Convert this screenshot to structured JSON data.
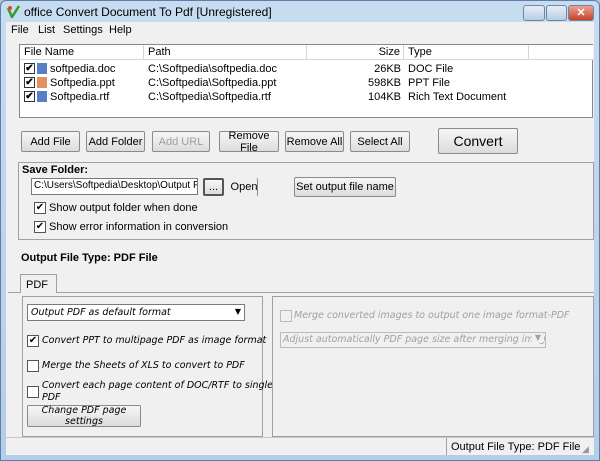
{
  "window": {
    "title": "office Convert Document To Pdf [Unregistered]"
  },
  "menu": [
    "File",
    "List",
    "Settings",
    "Help"
  ],
  "list": {
    "columns": [
      "File Name",
      "Path",
      "Size",
      "Type"
    ],
    "rows": [
      {
        "name": "softpedia.doc",
        "path": "C:\\Softpedia\\softpedia.doc",
        "size": "26KB",
        "type": "DOC File",
        "icon": "word-doc-icon",
        "checked": true
      },
      {
        "name": "Softpedia.ppt",
        "path": "C:\\Softpedia\\Softpedia.ppt",
        "size": "598KB",
        "type": "PPT File",
        "icon": "ppt-icon",
        "checked": true
      },
      {
        "name": "Softpedia.rtf",
        "path": "C:\\Softpedia\\Softpedia.rtf",
        "size": "104KB",
        "type": "Rich Text Document",
        "icon": "rtf-icon",
        "checked": true
      }
    ]
  },
  "toolbar": {
    "add_file": "Add File",
    "add_folder": "Add Folder",
    "add_url": "Add URL",
    "remove_file": "Remove File",
    "remove_all": "Remove All",
    "select_all": "Select All",
    "convert": "Convert"
  },
  "save": {
    "label": "Save Folder:",
    "path": "C:\\Users\\Softpedia\\Desktop\\Output Files",
    "browse": "...",
    "open": "Open",
    "set_name": "Set output file name",
    "show_folder": "Show output folder when done",
    "show_error": "Show error information in conversion"
  },
  "output": {
    "label": "Output File Type:  PDF File",
    "tab": "PDF"
  },
  "pdf": {
    "format": "Output PDF as default format",
    "ppt": "Convert PPT to multipage PDF as image format",
    "xls": "Merge the Sheets of XLS to convert to PDF",
    "doc1": "Convert each page content of DOC/RTF to single",
    "doc2": "PDF",
    "page_settings": "Change PDF page settings",
    "merge": "Merge converted images to output one image format-PDF",
    "adjust": "Adjust automatically PDF page size after merging images to PDF"
  },
  "status": {
    "right": "Output File Type:  PDF File"
  }
}
